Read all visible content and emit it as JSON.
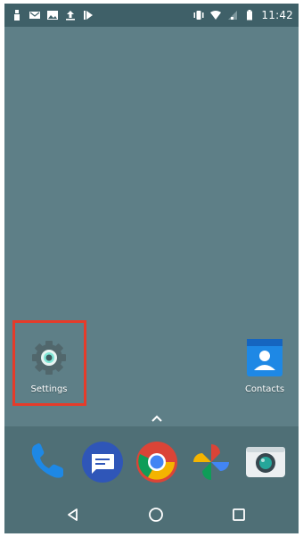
{
  "status_bar": {
    "time": "11:42",
    "left_icons": [
      "person-icon",
      "mail-icon",
      "image-icon",
      "upload-icon",
      "play-icon"
    ],
    "right_icons": [
      "vibrate-icon",
      "wifi-icon",
      "signal-icon",
      "battery-icon"
    ]
  },
  "home": {
    "apps": [
      {
        "label": "Settings",
        "icon": "settings-icon"
      },
      {
        "label": "Contacts",
        "icon": "contacts-icon"
      }
    ]
  },
  "dock": {
    "apps": [
      {
        "name": "phone",
        "icon": "phone-icon"
      },
      {
        "name": "messages",
        "icon": "messages-icon"
      },
      {
        "name": "chrome",
        "icon": "chrome-icon"
      },
      {
        "name": "photos",
        "icon": "photos-icon"
      },
      {
        "name": "camera",
        "icon": "camera-icon"
      }
    ]
  },
  "nav": {
    "buttons": [
      "back-icon",
      "home-icon",
      "recents-icon"
    ]
  },
  "colors": {
    "wallpaper": "#5e7f87",
    "status_bar": "#3f6068",
    "dock": "#4f6f76",
    "highlight_border": "#e53b2a"
  }
}
